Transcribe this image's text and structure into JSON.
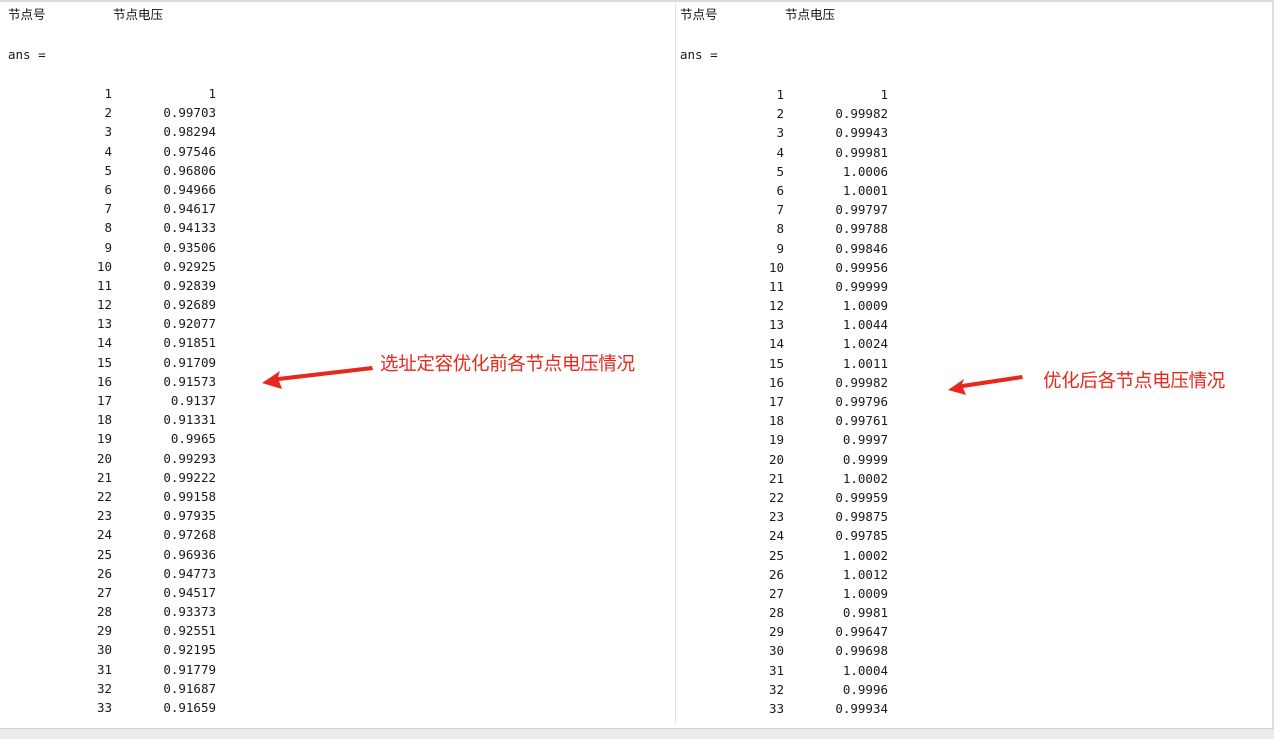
{
  "left": {
    "header_node": "节点号",
    "header_voltage": "节点电压",
    "ans_label": "ans =",
    "rows": [
      {
        "node": "1",
        "voltage": "1"
      },
      {
        "node": "2",
        "voltage": "0.99703"
      },
      {
        "node": "3",
        "voltage": "0.98294"
      },
      {
        "node": "4",
        "voltage": "0.97546"
      },
      {
        "node": "5",
        "voltage": "0.96806"
      },
      {
        "node": "6",
        "voltage": "0.94966"
      },
      {
        "node": "7",
        "voltage": "0.94617"
      },
      {
        "node": "8",
        "voltage": "0.94133"
      },
      {
        "node": "9",
        "voltage": "0.93506"
      },
      {
        "node": "10",
        "voltage": "0.92925"
      },
      {
        "node": "11",
        "voltage": "0.92839"
      },
      {
        "node": "12",
        "voltage": "0.92689"
      },
      {
        "node": "13",
        "voltage": "0.92077"
      },
      {
        "node": "14",
        "voltage": "0.91851"
      },
      {
        "node": "15",
        "voltage": "0.91709"
      },
      {
        "node": "16",
        "voltage": "0.91573"
      },
      {
        "node": "17",
        "voltage": "0.9137"
      },
      {
        "node": "18",
        "voltage": "0.91331"
      },
      {
        "node": "19",
        "voltage": "0.9965"
      },
      {
        "node": "20",
        "voltage": "0.99293"
      },
      {
        "node": "21",
        "voltage": "0.99222"
      },
      {
        "node": "22",
        "voltage": "0.99158"
      },
      {
        "node": "23",
        "voltage": "0.97935"
      },
      {
        "node": "24",
        "voltage": "0.97268"
      },
      {
        "node": "25",
        "voltage": "0.96936"
      },
      {
        "node": "26",
        "voltage": "0.94773"
      },
      {
        "node": "27",
        "voltage": "0.94517"
      },
      {
        "node": "28",
        "voltage": "0.93373"
      },
      {
        "node": "29",
        "voltage": "0.92551"
      },
      {
        "node": "30",
        "voltage": "0.92195"
      },
      {
        "node": "31",
        "voltage": "0.91779"
      },
      {
        "node": "32",
        "voltage": "0.91687"
      },
      {
        "node": "33",
        "voltage": "0.91659"
      }
    ],
    "annotation": "选址定容优化前各节点电压情况"
  },
  "right": {
    "header_node": "节点号",
    "header_voltage": "节点电压",
    "ans_label": "ans =",
    "rows": [
      {
        "node": "1",
        "voltage": "1"
      },
      {
        "node": "2",
        "voltage": "0.99982"
      },
      {
        "node": "3",
        "voltage": "0.99943"
      },
      {
        "node": "4",
        "voltage": "0.99981"
      },
      {
        "node": "5",
        "voltage": "1.0006"
      },
      {
        "node": "6",
        "voltage": "1.0001"
      },
      {
        "node": "7",
        "voltage": "0.99797"
      },
      {
        "node": "8",
        "voltage": "0.99788"
      },
      {
        "node": "9",
        "voltage": "0.99846"
      },
      {
        "node": "10",
        "voltage": "0.99956"
      },
      {
        "node": "11",
        "voltage": "0.99999"
      },
      {
        "node": "12",
        "voltage": "1.0009"
      },
      {
        "node": "13",
        "voltage": "1.0044"
      },
      {
        "node": "14",
        "voltage": "1.0024"
      },
      {
        "node": "15",
        "voltage": "1.0011"
      },
      {
        "node": "16",
        "voltage": "0.99982"
      },
      {
        "node": "17",
        "voltage": "0.99796"
      },
      {
        "node": "18",
        "voltage": "0.99761"
      },
      {
        "node": "19",
        "voltage": "0.9997"
      },
      {
        "node": "20",
        "voltage": "0.9999"
      },
      {
        "node": "21",
        "voltage": "1.0002"
      },
      {
        "node": "22",
        "voltage": "0.99959"
      },
      {
        "node": "23",
        "voltage": "0.99875"
      },
      {
        "node": "24",
        "voltage": "0.99785"
      },
      {
        "node": "25",
        "voltage": "1.0002"
      },
      {
        "node": "26",
        "voltage": "1.0012"
      },
      {
        "node": "27",
        "voltage": "1.0009"
      },
      {
        "node": "28",
        "voltage": "0.9981"
      },
      {
        "node": "29",
        "voltage": "0.99647"
      },
      {
        "node": "30",
        "voltage": "0.99698"
      },
      {
        "node": "31",
        "voltage": "1.0004"
      },
      {
        "node": "32",
        "voltage": "0.9996"
      },
      {
        "node": "33",
        "voltage": "0.99934"
      }
    ],
    "annotation": "优化后各节点电压情况"
  },
  "colors": {
    "annotation_red": "#e8281c",
    "text": "#1a1a1a"
  },
  "icons": {
    "annotation_arrow": "red-arrow-left-icon"
  }
}
